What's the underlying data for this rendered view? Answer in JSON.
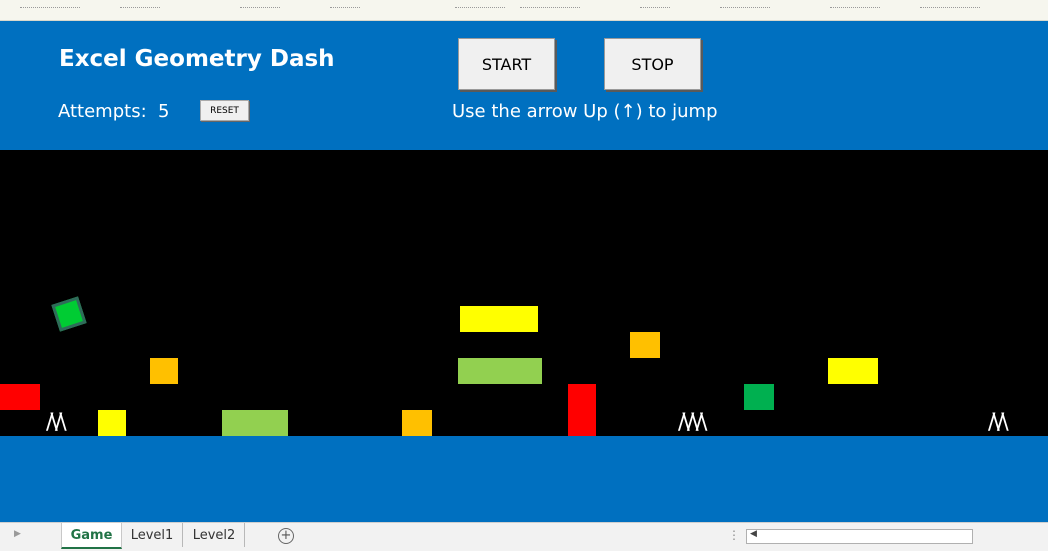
{
  "header": {
    "title": "Excel Geometry Dash",
    "attempts_label": "Attempts:",
    "attempts_value": "5",
    "reset_label": "RESET",
    "start_label": "START",
    "stop_label": "STOP",
    "instructions": "Use the arrow Up (↑) to jump"
  },
  "game": {
    "player_color": "#00cc33",
    "spike_glyph": "/\\/\\",
    "spike_glyph_triple": "/\\/\\/\\",
    "colors": {
      "red": "#ff0000",
      "yellow": "#ffff00",
      "orange": "#ffc000",
      "light_green": "#92d050",
      "dark_green": "#00b050"
    }
  },
  "sheet_tabs": [
    {
      "label": "Game",
      "active": true
    },
    {
      "label": "Level1",
      "active": false
    },
    {
      "label": "Level2",
      "active": false
    }
  ],
  "icons": {
    "add_sheet": "+",
    "scroll_left": "▶",
    "scroll_arrow": "◀",
    "dots": "⋮"
  }
}
